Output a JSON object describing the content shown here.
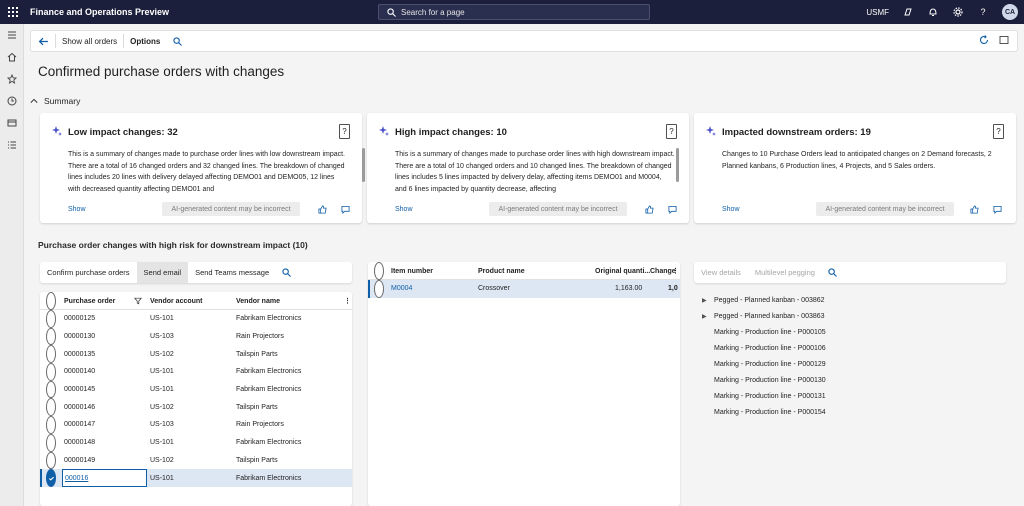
{
  "topbar": {
    "app_title": "Finance and Operations Preview",
    "search_placeholder": "Search for a page",
    "company": "USMF",
    "avatar_initials": "CA"
  },
  "actionbar": {
    "show_all_orders": "Show all orders",
    "options": "Options"
  },
  "page": {
    "title": "Confirmed purchase orders with changes",
    "summary_label": "Summary",
    "section_title": "Purchase order changes with high risk for downstream impact (10)"
  },
  "cards": [
    {
      "title": "Low impact changes: 32",
      "body": "This is a summary of changes made to purchase order lines with low downstream impact. There are a total of 16 changed orders and 32 changed lines. The breakdown of changed lines includes 20 lines with delivery delayed affecting DEMO01 and DEMO05, 12 lines with decreased quantity affecting DEMO01 and",
      "show": "Show",
      "ai_note": "AI-generated content may be incorrect",
      "help": "?"
    },
    {
      "title": "High impact changes: 10",
      "body": "This is a summary of changes made to purchase order lines with high downstream impact. There are a total of 10 changed orders and 10 changed lines. The breakdown of changed lines includes 5 lines impacted by delivery delay, affecting items DEMO01 and M0004, and 6 lines impacted by quantity decrease, affecting",
      "show": "Show",
      "ai_note": "AI-generated content may be incorrect",
      "help": "?"
    },
    {
      "title": "Impacted downstream orders: 19",
      "body": "Changes to 10 Purchase Orders lead to anticipated changes on 2 Demand forecasts, 2 Planned kanbans, 6 Production lines, 4 Projects, and 5 Sales orders.",
      "show": "Show",
      "ai_note": "AI-generated content may be incorrect",
      "help": "?"
    }
  ],
  "left_toolbar": {
    "confirm": "Confirm purchase orders",
    "send_email": "Send email",
    "send_teams": "Send Teams message"
  },
  "po_grid": {
    "headers": {
      "po": "Purchase order",
      "vendor": "Vendor account",
      "name": "Vendor name"
    },
    "rows": [
      {
        "po": "00000125",
        "vendor": "US-101",
        "name": "Fabrikam Electronics"
      },
      {
        "po": "00000130",
        "vendor": "US-103",
        "name": "Rain Projectors"
      },
      {
        "po": "00000135",
        "vendor": "US-102",
        "name": "Tailspin Parts"
      },
      {
        "po": "00000140",
        "vendor": "US-101",
        "name": "Fabrikam Electronics"
      },
      {
        "po": "00000145",
        "vendor": "US-101",
        "name": "Fabrikam Electronics"
      },
      {
        "po": "00000146",
        "vendor": "US-102",
        "name": "Tailspin Parts"
      },
      {
        "po": "00000147",
        "vendor": "US-103",
        "name": "Rain Projectors"
      },
      {
        "po": "00000148",
        "vendor": "US-101",
        "name": "Fabrikam Electronics"
      },
      {
        "po": "00000149",
        "vendor": "US-102",
        "name": "Tailspin Parts"
      },
      {
        "po": "000016",
        "vendor": "US-101",
        "name": "Fabrikam Electronics"
      }
    ]
  },
  "item_grid": {
    "headers": {
      "item": "Item number",
      "product": "Product name",
      "orig_qty": "Original quanti...",
      "change": "Change"
    },
    "rows": [
      {
        "item": "M0004",
        "product": "Crossover",
        "orig_qty": "1,163.00",
        "change": "1,0"
      }
    ]
  },
  "right_toolbar": {
    "view_details": "View details",
    "multilevel": "Multilevel pegging"
  },
  "pegging": [
    {
      "label": "Pegged - Planned kanban - 003862",
      "expandable": true
    },
    {
      "label": "Pegged - Planned kanban - 003863",
      "expandable": true
    },
    {
      "label": "Marking - Production line - P000105",
      "expandable": false
    },
    {
      "label": "Marking - Production line - P000106",
      "expandable": false
    },
    {
      "label": "Marking - Production line - P000129",
      "expandable": false
    },
    {
      "label": "Marking - Production line - P000130",
      "expandable": false
    },
    {
      "label": "Marking - Production line - P000131",
      "expandable": false
    },
    {
      "label": "Marking - Production line - P000154",
      "expandable": false
    }
  ],
  "colors": {
    "nav": "#1b1f3b",
    "accent": "#0f5ea8",
    "selected_row": "#dde6f3"
  }
}
